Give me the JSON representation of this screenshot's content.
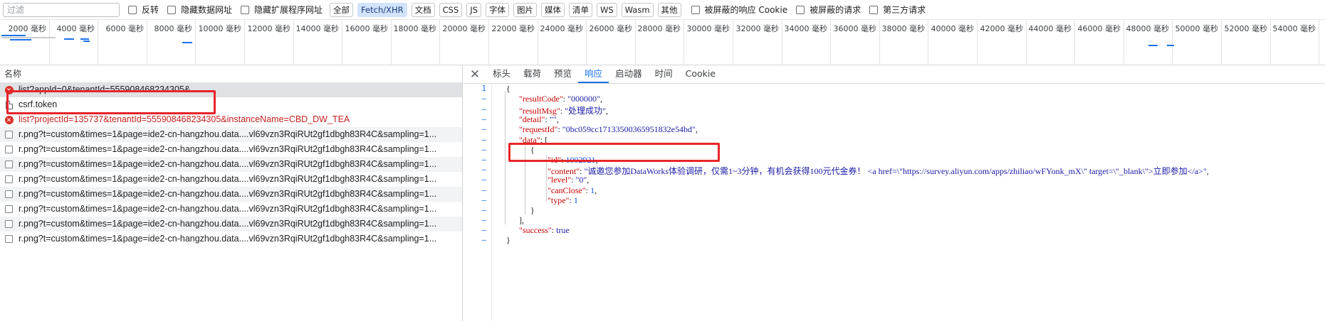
{
  "filter": {
    "placeholder": "过滤",
    "invert": "反转",
    "hide_data_urls": "隐藏数据网址",
    "hide_ext_urls": "隐藏扩展程序网址",
    "types": [
      "全部",
      "Fetch/XHR",
      "文档",
      "CSS",
      "JS",
      "字体",
      "图片",
      "媒体",
      "清单",
      "WS",
      "Wasm",
      "其他"
    ],
    "active_type": "Fetch/XHR",
    "blocked_cookies": "被屏蔽的响应 Cookie",
    "blocked_requests": "被屏蔽的请求",
    "third_party": "第三方请求"
  },
  "timeline": {
    "ticks": [
      "2000 毫秒",
      "4000 毫秒",
      "6000 毫秒",
      "8000 毫秒",
      "10000 毫秒",
      "12000 毫秒",
      "14000 毫秒",
      "16000 毫秒",
      "18000 毫秒",
      "20000 毫秒",
      "22000 毫秒",
      "24000 毫秒",
      "26000 毫秒",
      "28000 毫秒",
      "30000 毫秒",
      "32000 毫秒",
      "34000 毫秒",
      "36000 毫秒",
      "38000 毫秒",
      "40000 毫秒",
      "42000 毫秒",
      "44000 毫秒",
      "46000 毫秒",
      "48000 毫秒",
      "50000 毫秒",
      "52000 毫秒",
      "54000 毫秒"
    ]
  },
  "requests": {
    "header": "名称",
    "rows": [
      {
        "name": "list?appId=0&tenantId=555908468234305&",
        "icon": "error",
        "state": "selected"
      },
      {
        "name": "csrf.token",
        "icon": "document",
        "state": "normal"
      },
      {
        "name": "list?projectId=135737&tenantId=555908468234305&instanceName=CBD_DW_TEA",
        "icon": "error",
        "state": "error"
      },
      {
        "name": "r.png?t=custom&times=1&page=ide2-cn-hangzhou.data....vl69vzn3RqiRUt2gf1dbgh83R4C&sampling=1...",
        "icon": "image",
        "state": "alt"
      },
      {
        "name": "r.png?t=custom&times=1&page=ide2-cn-hangzhou.data....vl69vzn3RqiRUt2gf1dbgh83R4C&sampling=1...",
        "icon": "image",
        "state": "normal"
      },
      {
        "name": "r.png?t=custom&times=1&page=ide2-cn-hangzhou.data....vl69vzn3RqiRUt2gf1dbgh83R4C&sampling=1...",
        "icon": "image",
        "state": "alt"
      },
      {
        "name": "r.png?t=custom&times=1&page=ide2-cn-hangzhou.data....vl69vzn3RqiRUt2gf1dbgh83R4C&sampling=1...",
        "icon": "image",
        "state": "normal"
      },
      {
        "name": "r.png?t=custom&times=1&page=ide2-cn-hangzhou.data....vl69vzn3RqiRUt2gf1dbgh83R4C&sampling=1...",
        "icon": "image",
        "state": "alt"
      },
      {
        "name": "r.png?t=custom&times=1&page=ide2-cn-hangzhou.data....vl69vzn3RqiRUt2gf1dbgh83R4C&sampling=1...",
        "icon": "image",
        "state": "normal"
      },
      {
        "name": "r.png?t=custom&times=1&page=ide2-cn-hangzhou.data....vl69vzn3RqiRUt2gf1dbgh83R4C&sampling=1...",
        "icon": "image",
        "state": "alt"
      },
      {
        "name": "r.png?t=custom&times=1&page=ide2-cn-hangzhou.data....vl69vzn3RqiRUt2gf1dbgh83R4C&sampling=1...",
        "icon": "image",
        "state": "normal"
      }
    ]
  },
  "detail": {
    "close_icon": "close-icon",
    "tabs": [
      "标头",
      "载荷",
      "预览",
      "响应",
      "启动器",
      "时间",
      "Cookie"
    ],
    "active_tab": "响应",
    "gutter": [
      "1",
      "–",
      "–",
      "–",
      "–",
      "–",
      "–",
      "–",
      "–",
      "–",
      "–",
      "–",
      "–",
      "–",
      "–",
      "–"
    ],
    "response": {
      "resultCode": "000000",
      "resultMsg": "处理成功",
      "detail": "",
      "requestId": "0bc059cc17133500365951832e54bd",
      "data": {
        "id": "1002921",
        "content": "诚邀您参加DataWorks体验调研，仅需1~3分钟，有机会获得100元代金券！ <a href=\\\"https://survey.aliyun.com/apps/zhiliao/wFYonk_mX\\\" target=\\\"_blank\\\">立即参加</a>",
        "level": "0",
        "canClose": "1",
        "type": "1"
      },
      "success": "true"
    }
  },
  "colors": {
    "accent": "#1a73e8",
    "error": "#d93025",
    "highlight_box": "#e8252a",
    "json_key": "#c80000",
    "json_string": "#1a1aa6"
  }
}
